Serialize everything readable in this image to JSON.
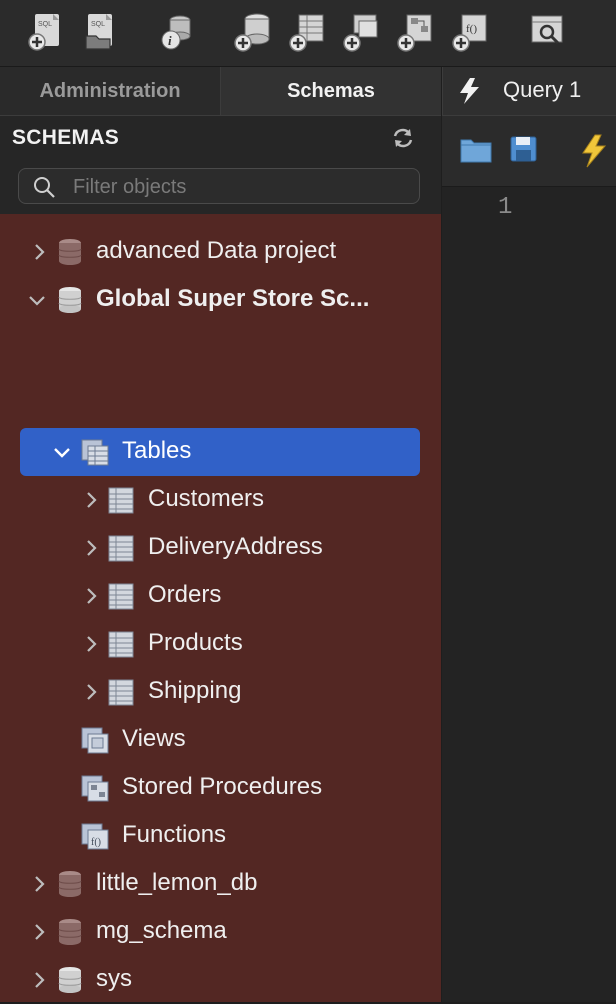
{
  "sidebar_tabs": {
    "administration": "Administration",
    "schemas": "Schemas"
  },
  "editor_tab": {
    "label": "Query 1"
  },
  "panel": {
    "title": "SCHEMAS",
    "search_placeholder": "Filter objects"
  },
  "tree": {
    "schemas": [
      {
        "name": "advanced Data project",
        "expanded": false
      },
      {
        "name": "Global Super Store Sc...",
        "expanded": true,
        "bold": true
      },
      {
        "name": "little_lemon_db",
        "expanded": false
      },
      {
        "name": "mg_schema",
        "expanded": false
      },
      {
        "name": "sys",
        "expanded": false
      }
    ],
    "tables_label": "Tables",
    "tables": [
      "Customers",
      "DeliveryAddress",
      "Orders",
      "Products",
      "Shipping"
    ],
    "views_label": "Views",
    "procedures_label": "Stored Procedures",
    "functions_label": "Functions"
  },
  "editor": {
    "line_numbers": [
      "1"
    ]
  },
  "colors": {
    "tree_background": "#532723",
    "selection": "#3161c8",
    "bolt": "#f0c63a"
  },
  "toolbar_icons": [
    "new-sql-file-icon",
    "open-sql-file-icon",
    "schema-info-icon",
    "create-schema-icon",
    "create-table-icon",
    "create-view-icon",
    "create-procedure-icon",
    "create-function-icon",
    "inspector-icon"
  ]
}
